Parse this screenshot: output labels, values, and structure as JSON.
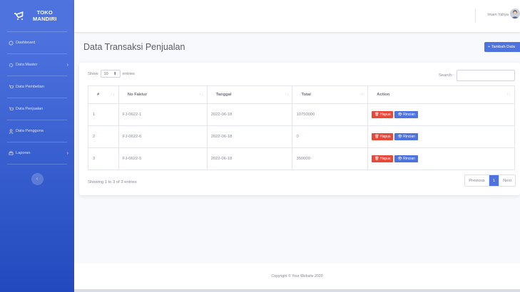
{
  "brand": {
    "line1": "TOKO",
    "line2": "MANDIRI"
  },
  "sidebar": {
    "items": [
      {
        "label": "Dashboard",
        "icon": "dashboard-icon"
      },
      {
        "label": "Data Master",
        "icon": "gear-icon",
        "caret": "›"
      },
      {
        "label": "Data Pembelian",
        "icon": "cart-icon"
      },
      {
        "label": "Data Penjualan",
        "icon": "cart-icon"
      },
      {
        "label": "Data Pengguna",
        "icon": "user-icon"
      },
      {
        "label": "Laporan",
        "icon": "print-icon",
        "caret": "›"
      }
    ],
    "toggle": "‹"
  },
  "topbar": {
    "user_name": "Imam Yahya"
  },
  "page": {
    "title": "Data Transaksi Penjualan",
    "add_button": "+ Tambah Data"
  },
  "table_controls": {
    "show_label": "Show",
    "length_value": "10",
    "entries_label": "entries",
    "search_label": "Search:"
  },
  "table": {
    "headers": [
      "#",
      "No Faktur",
      "Tanggal",
      "Total",
      "Action"
    ],
    "rows": [
      {
        "no": "1",
        "faktur": "FJ-0622-1",
        "tanggal": "2022-06-18",
        "total": "10750000"
      },
      {
        "no": "2",
        "faktur": "FJ-0622-6",
        "tanggal": "2022-06-18",
        "total": "0"
      },
      {
        "no": "3",
        "faktur": "FJ-0622-5",
        "tanggal": "2022-06-18",
        "total": "350000"
      }
    ],
    "action_hapus": "Hapus",
    "action_rincian": "Rincian"
  },
  "table_info": "Showing 1 to 3 of 3 entries",
  "pagination": {
    "previous": "Previous",
    "current": "1",
    "next": "Next"
  },
  "footer": "Copyright © Your Website 2020",
  "colors": {
    "primary": "#4e73df",
    "danger": "#e74a3b",
    "background": "#f8f9fc"
  }
}
